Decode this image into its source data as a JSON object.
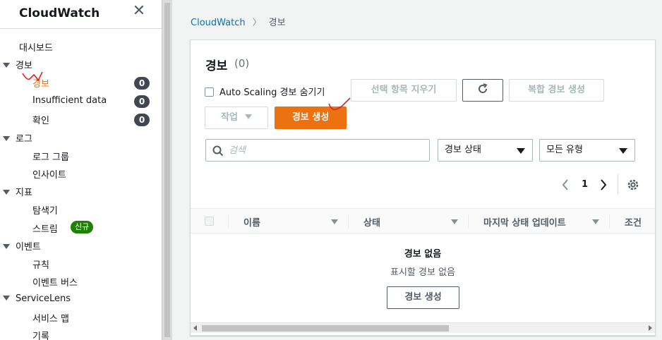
{
  "sidebar": {
    "title": "CloudWatch",
    "sections": {
      "dashboard": "대시보드",
      "alarms": "경보",
      "alarms_all": "경보",
      "alarms_insufficient": "Insufficient data",
      "alarms_ok": "확인",
      "logs": "로그",
      "log_groups": "로그 그룹",
      "insights": "인사이트",
      "metrics": "지표",
      "explorer": "탐색기",
      "streams": "스트림",
      "streams_badge": "신규",
      "events": "이벤트",
      "rules": "규칙",
      "event_buses": "이벤트 버스",
      "servicelens": "ServiceLens",
      "service_map": "서비스 맵",
      "traces": "기록"
    },
    "counts": {
      "alarms_all": "0",
      "insufficient": "0",
      "ok": "0"
    }
  },
  "breadcrumb": {
    "root": "CloudWatch",
    "current": "경보"
  },
  "panel": {
    "title": "경보",
    "count": "(0)",
    "hide_autoscaling_label": "Auto Scaling 경보 숨기기",
    "clear_selection": "선택 항목 지우기",
    "create_composite": "복합 경보 생성",
    "actions": "작업",
    "create_alarm": "경보 생성",
    "search_placeholder": "검색",
    "state_filter": "경보 상태",
    "type_filter": "모든 유형",
    "page_number": "1",
    "columns": [
      "이름",
      "상태",
      "마지막 상태 업데이트",
      "조건"
    ],
    "empty_title": "경보 없음",
    "empty_subtitle": "표시할 경보 없음",
    "empty_create": "경보 생성"
  },
  "colors": {
    "accent": "#ec7211",
    "link": "#0073bb",
    "badge_new": "#1d8102",
    "badge_count": "#414750"
  },
  "icons": [
    "close-icon",
    "refresh-icon",
    "search-icon",
    "chevron-left-icon",
    "chevron-right-icon",
    "gear-icon",
    "caret-down-icon"
  ]
}
